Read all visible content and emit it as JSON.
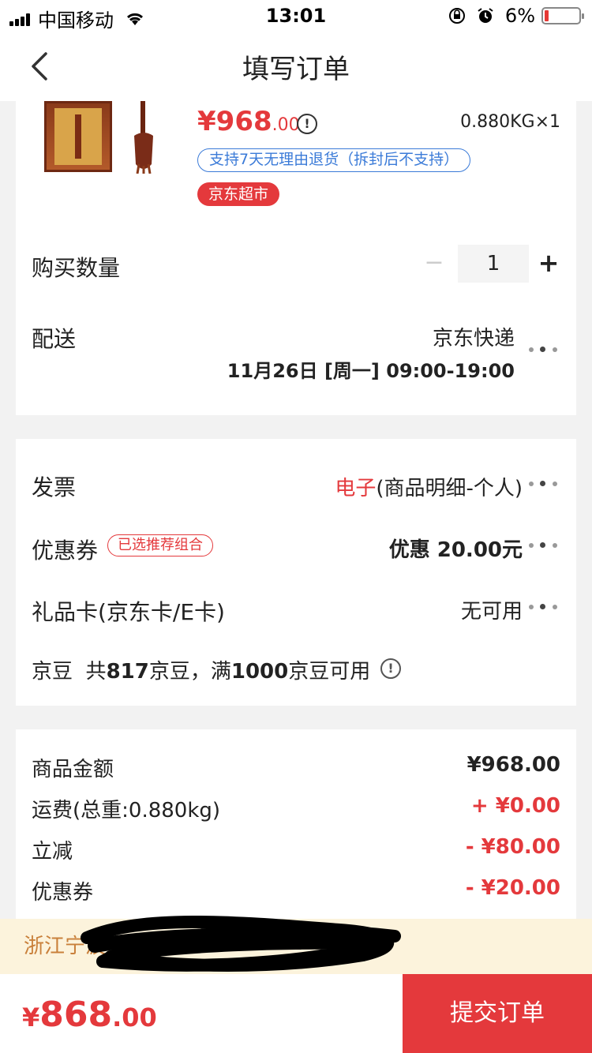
{
  "status_bar": {
    "carrier": "中国移动",
    "time": "13:01",
    "battery": "6%"
  },
  "nav": {
    "title": "填写订单"
  },
  "product": {
    "price_main": "¥968",
    "price_decimal": ".00",
    "weight": "0.880KG×1",
    "return_policy": "支持7天无理由退货（拆封后不支持）",
    "store_tag": "京东超市"
  },
  "quantity": {
    "label": "购买数量",
    "value": "1",
    "minus": "−",
    "plus": "+"
  },
  "delivery": {
    "label": "配送",
    "carrier": "京东快递",
    "time": "11月26日 [周一] 09:00-19:00"
  },
  "invoice": {
    "label": "发票",
    "type": "电子",
    "detail": "(商品明细-个人)"
  },
  "coupon": {
    "label": "优惠券",
    "tag": "已选推荐组合",
    "value": "优惠 20.00元"
  },
  "gift_card": {
    "label": "礼品卡(京东卡/E卡)",
    "value": "无可用"
  },
  "jd_beans": {
    "label": "京豆",
    "prefix": "共",
    "count": "817",
    "mid": "京豆，满",
    "threshold": "1000",
    "suffix": "京豆可用"
  },
  "summary": {
    "items": [
      {
        "label": "商品金额",
        "value": "¥968.00"
      },
      {
        "label": "运费(总重:0.880kg)",
        "value": "+ ¥0.00"
      },
      {
        "label": "立减",
        "value": "- ¥80.00"
      },
      {
        "label": "优惠券",
        "value": "- ¥20.00"
      }
    ]
  },
  "address": {
    "text": "浙江宁波"
  },
  "footer": {
    "currency": "¥",
    "total_main": "868",
    "total_decimal": ".00",
    "submit_label": "提交订单"
  },
  "colors": {
    "accent_red": "#e4393c",
    "link_blue": "#3b7bd8",
    "address_bg": "#fcf3dc"
  }
}
